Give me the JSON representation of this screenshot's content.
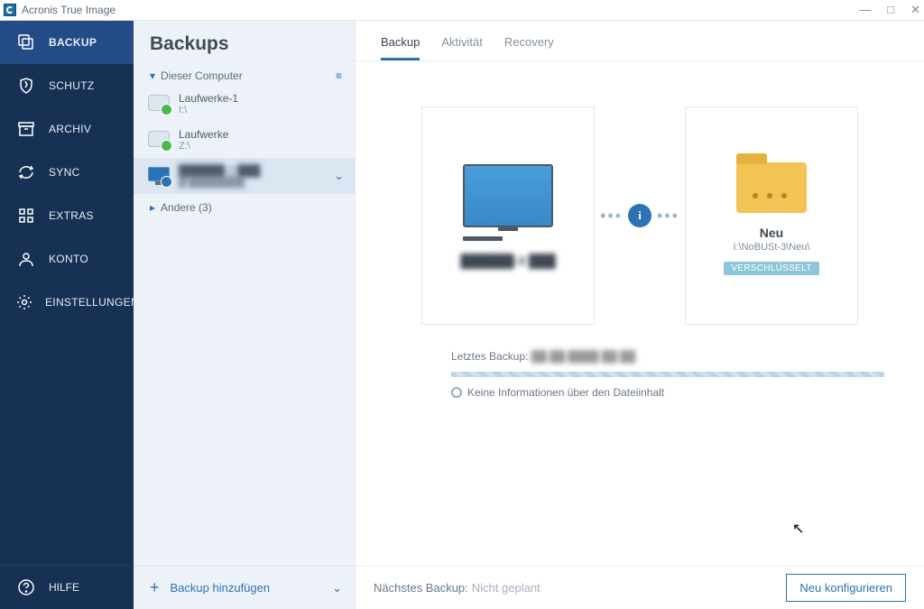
{
  "app_title": "Acronis True Image",
  "window_buttons": {
    "minimize": "—",
    "maximize": "□",
    "close": "✕"
  },
  "sidebar": {
    "items": [
      {
        "label": "BACKUP"
      },
      {
        "label": "SCHUTZ"
      },
      {
        "label": "ARCHIV"
      },
      {
        "label": "SYNC"
      },
      {
        "label": "EXTRAS"
      },
      {
        "label": "KONTO"
      },
      {
        "label": "EINSTELLUNGEN"
      }
    ],
    "help": "HILFE"
  },
  "backups": {
    "title": "Backups",
    "group": "Dieser Computer",
    "items": [
      {
        "name": "Laufwerke-1",
        "sub": "I:\\"
      },
      {
        "name": "Laufwerke",
        "sub": "Z:\\"
      },
      {
        "name": "██████-3 ███",
        "sub": "█\\████████"
      }
    ],
    "other": "Andere (3)",
    "add": "Backup hinzufügen"
  },
  "tabs": [
    {
      "label": "Backup",
      "active": true
    },
    {
      "label": "Aktivität",
      "active": false
    },
    {
      "label": "Recovery",
      "active": false
    }
  ],
  "source": {
    "name": "██████-3 ███"
  },
  "destination": {
    "name": "Neu",
    "path": "I:\\NoBUSt-3\\Neu\\",
    "badge": "VERSCHLÜSSELT"
  },
  "last_backup": {
    "label": "Letztes Backup:",
    "value": "██.██.████ ██:██"
  },
  "noinfo": "Keine Informationen über den Dateiinhalt",
  "next_backup": {
    "label": "Nächstes Backup:",
    "value": "Nicht geplant"
  },
  "configure_btn": "Neu konfigurieren"
}
